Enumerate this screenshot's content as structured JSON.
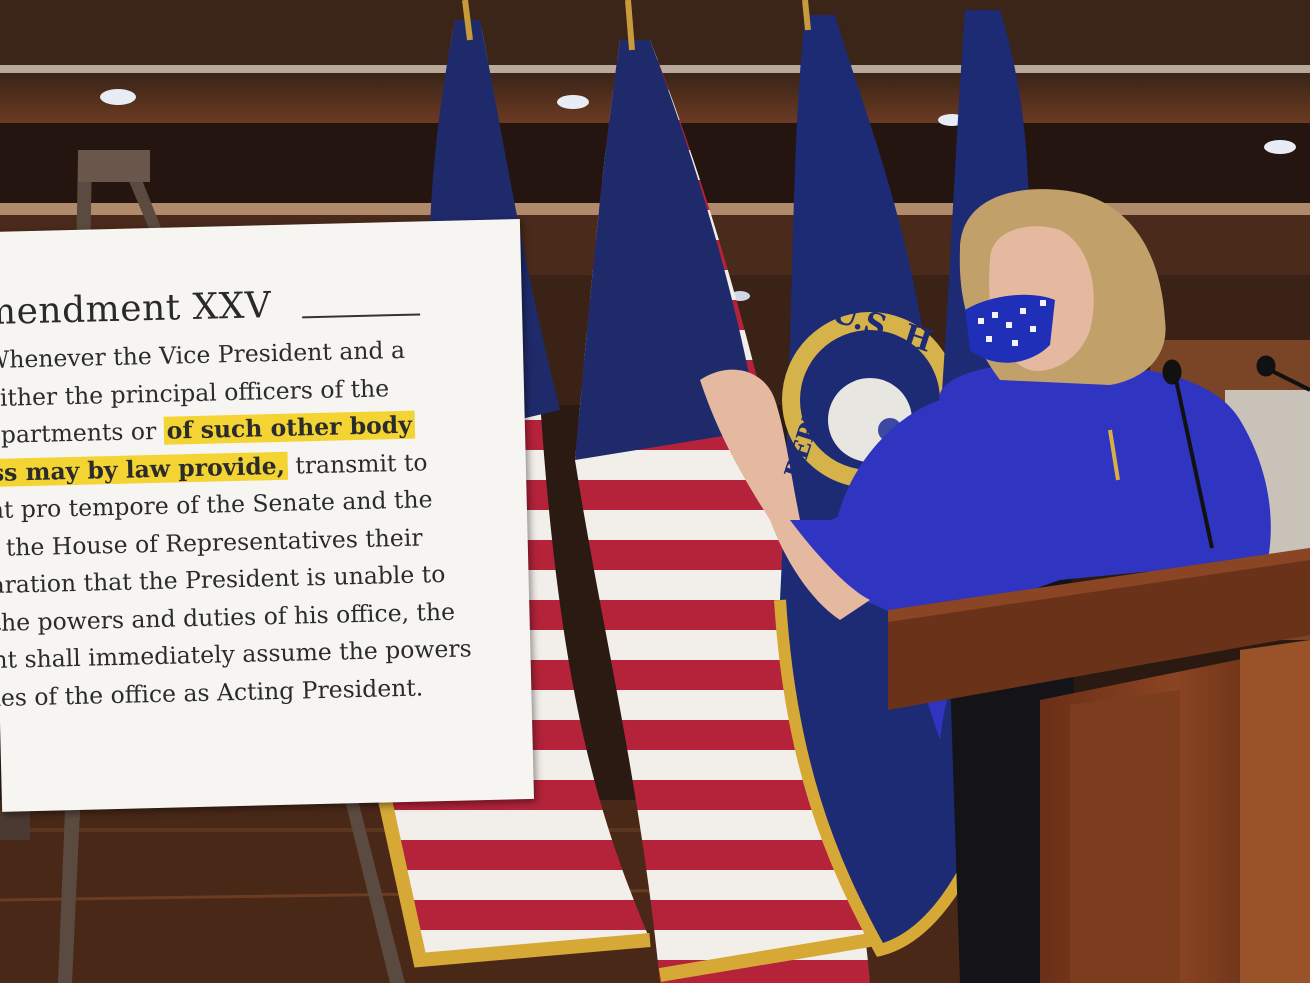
{
  "sign": {
    "title": "mendment XXV",
    "lines": [
      {
        "pre": "Whenever the Vice President and a",
        "hl": "",
        "post": ""
      },
      {
        "pre": "either the principal officers of the",
        "hl": "",
        "post": ""
      },
      {
        "pre": "epartments or ",
        "hl": "of such other body",
        "post": ""
      },
      {
        "pre": "",
        "hl": "ss may by law provide,",
        "post": " transmit to"
      },
      {
        "pre": "nt pro tempore of the Senate and the",
        "hl": "",
        "post": ""
      },
      {
        "pre": "f the House of Representatives their",
        "hl": "",
        "post": ""
      },
      {
        "pre": "aration that the President is unable to",
        "hl": "",
        "post": ""
      },
      {
        "pre": "the powers and duties of his office, the",
        "hl": "",
        "post": ""
      },
      {
        "pre": "nt shall immediately assume the powers",
        "hl": "",
        "post": ""
      },
      {
        "pre": "ies of the office as Acting President.",
        "hl": "",
        "post": ""
      }
    ]
  },
  "seal": {
    "text": "U.S. H",
    "text2": "REPRES"
  },
  "colors": {
    "highlight": "#f3d432",
    "suit": "#2f35c0",
    "flag_red": "#b4233a",
    "flag_blue": "#1f2a6b",
    "navy_flag": "#1d2a74",
    "podium": "#7a3a1e"
  }
}
